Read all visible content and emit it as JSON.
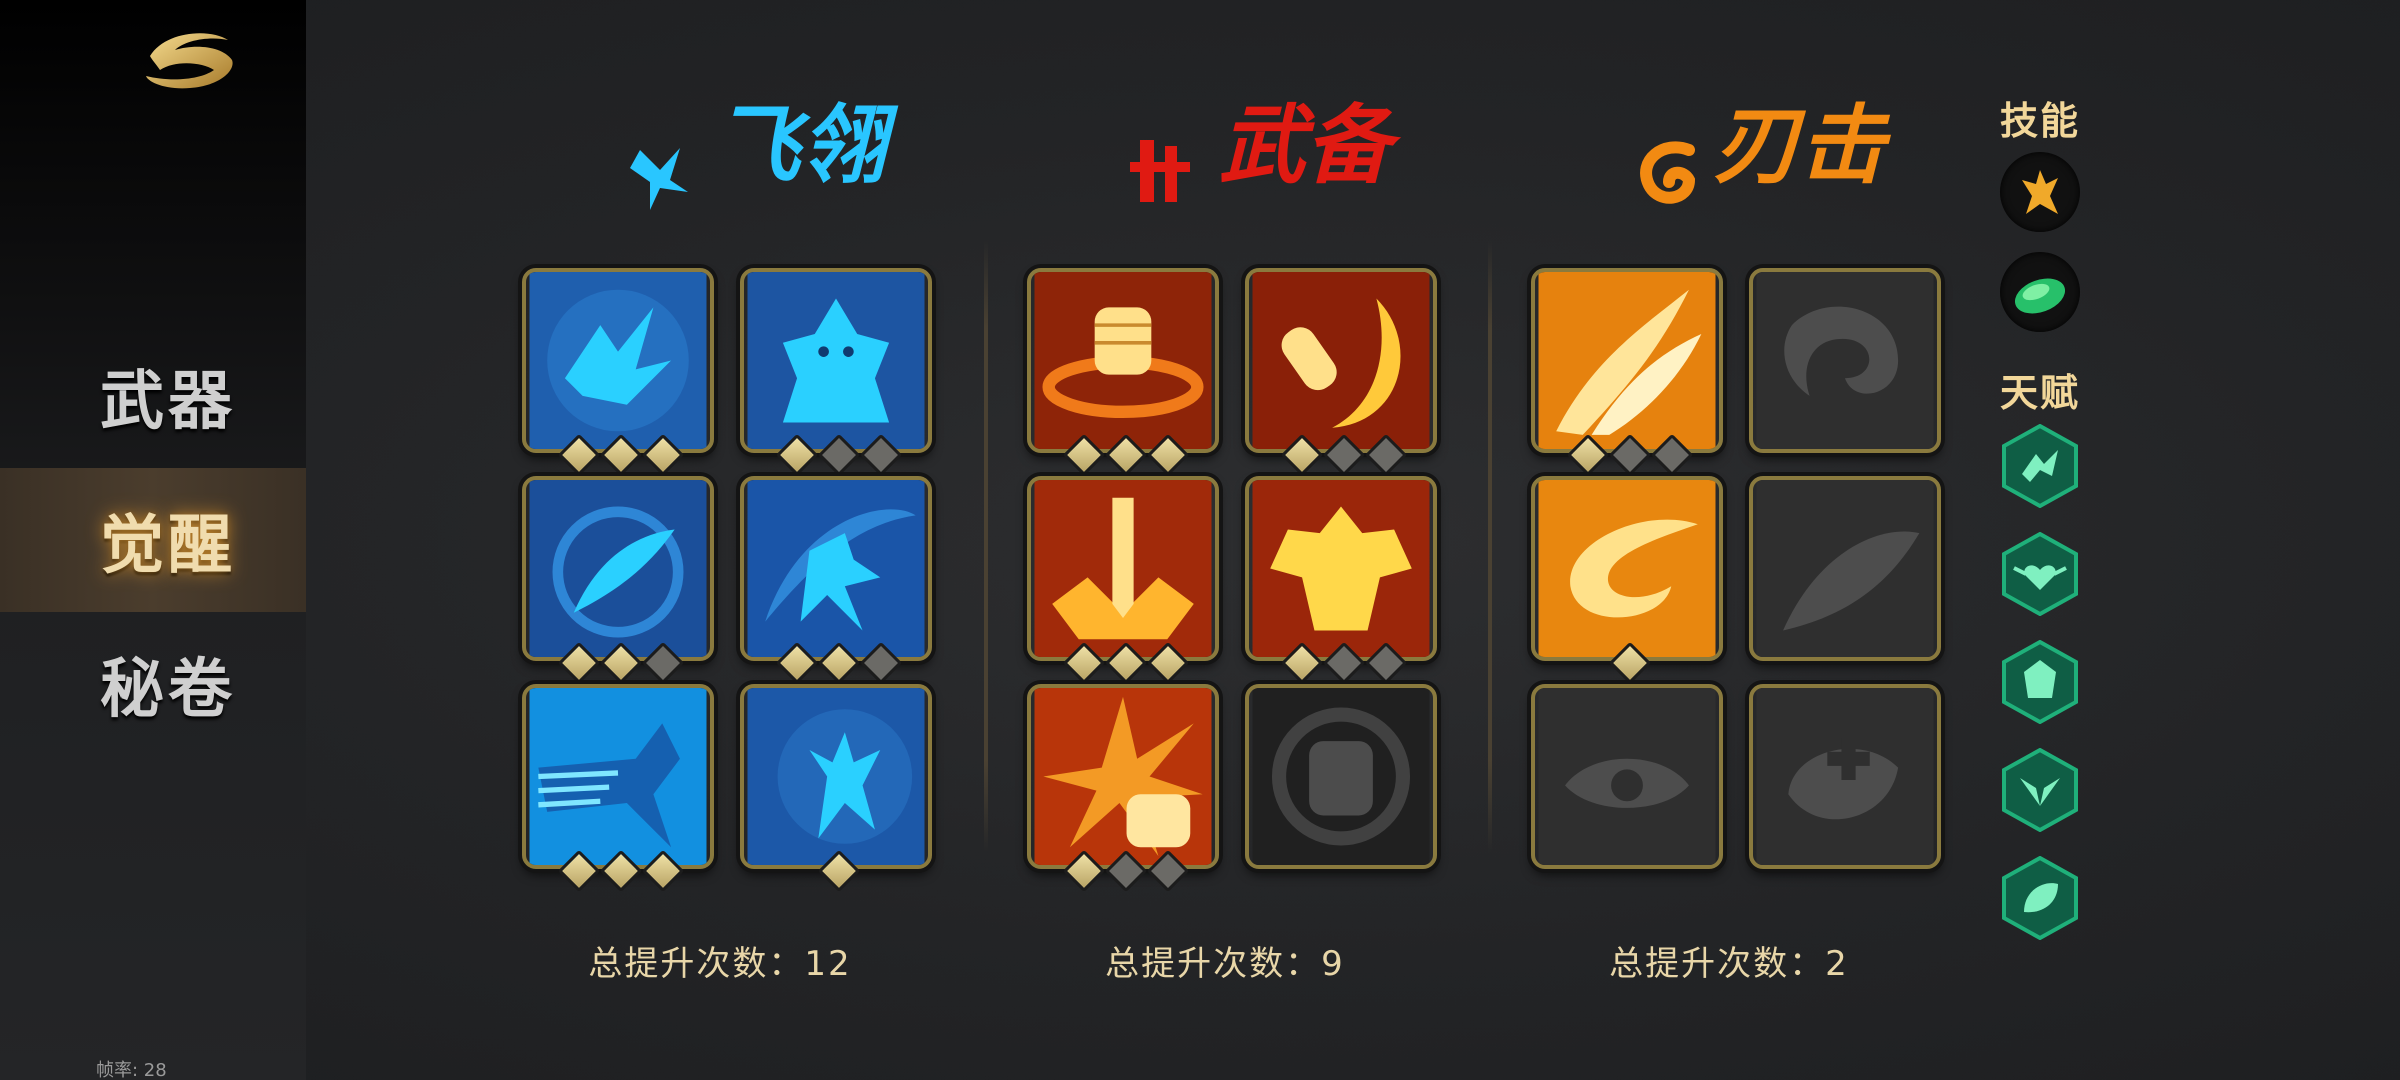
{
  "sidebar": {
    "items": [
      {
        "label": "武器",
        "active": false
      },
      {
        "label": "觉醒",
        "active": true
      },
      {
        "label": "秘卷",
        "active": false
      }
    ],
    "fps_label": "帧率: 28"
  },
  "columns": [
    {
      "title": "飞翎",
      "theme_color": "#29c6ff",
      "total_label": "总提升次数：12",
      "tiles": [
        {
          "icon": "claw-wing-icon",
          "gems_on": 3,
          "gems_total": 3,
          "locked": false
        },
        {
          "icon": "bird-demon-icon",
          "gems_on": 1,
          "gems_total": 3,
          "locked": false
        },
        {
          "icon": "feather-orbit-icon",
          "gems_on": 2,
          "gems_total": 3,
          "locked": false
        },
        {
          "icon": "bird-slash-icon",
          "gems_on": 2,
          "gems_total": 3,
          "locked": false
        },
        {
          "icon": "bird-dash-icon",
          "gems_on": 3,
          "gems_total": 3,
          "locked": false
        },
        {
          "icon": "claw-strike-icon",
          "gems_on": 1,
          "gems_total": 1,
          "locked": false
        }
      ]
    },
    {
      "title": "武备",
      "theme_color": "#e01a12",
      "total_label": "总提升次数：9",
      "tiles": [
        {
          "icon": "fist-whirl-icon",
          "gems_on": 3,
          "gems_total": 3,
          "locked": false
        },
        {
          "icon": "crescent-strike-icon",
          "gems_on": 1,
          "gems_total": 3,
          "locked": false
        },
        {
          "icon": "sword-ground-icon",
          "gems_on": 3,
          "gems_total": 3,
          "locked": false
        },
        {
          "icon": "muscle-warrior-icon",
          "gems_on": 1,
          "gems_total": 3,
          "locked": false
        },
        {
          "icon": "fist-burst-icon",
          "gems_on": 1,
          "gems_total": 3,
          "locked": false
        },
        {
          "icon": "fist-shield-icon",
          "gems_on": 0,
          "gems_total": 0,
          "locked": true
        }
      ]
    },
    {
      "title": "刃击",
      "theme_color": "#f28a12",
      "total_label": "总提升次数：2",
      "tiles": [
        {
          "icon": "flame-slash-icon",
          "gems_on": 1,
          "gems_total": 3,
          "locked": false
        },
        {
          "icon": "vortex-icon",
          "gems_on": 0,
          "gems_total": 0,
          "locked": true
        },
        {
          "icon": "swirl-blade-icon",
          "gems_on": 1,
          "gems_total": 1,
          "locked": false
        },
        {
          "icon": "feather-sweep-icon",
          "gems_on": 0,
          "gems_total": 0,
          "locked": true
        },
        {
          "icon": "eye-vortex-icon",
          "gems_on": 0,
          "gems_total": 0,
          "locked": true
        },
        {
          "icon": "heal-vortex-icon",
          "gems_on": 0,
          "gems_total": 0,
          "locked": true
        }
      ]
    }
  ],
  "right_panel": {
    "skills_heading": "技能",
    "skills": [
      {
        "icon": "golden-claw-icon"
      },
      {
        "icon": "green-leaf-icon"
      }
    ],
    "talents_heading": "天赋",
    "talents": [
      {
        "icon": "talent-bird-icon"
      },
      {
        "icon": "talent-heart-wing-icon"
      },
      {
        "icon": "talent-gem-icon"
      },
      {
        "icon": "talent-wings-icon"
      },
      {
        "icon": "talent-leaf-icon"
      }
    ],
    "accent": "#1fb07a"
  }
}
